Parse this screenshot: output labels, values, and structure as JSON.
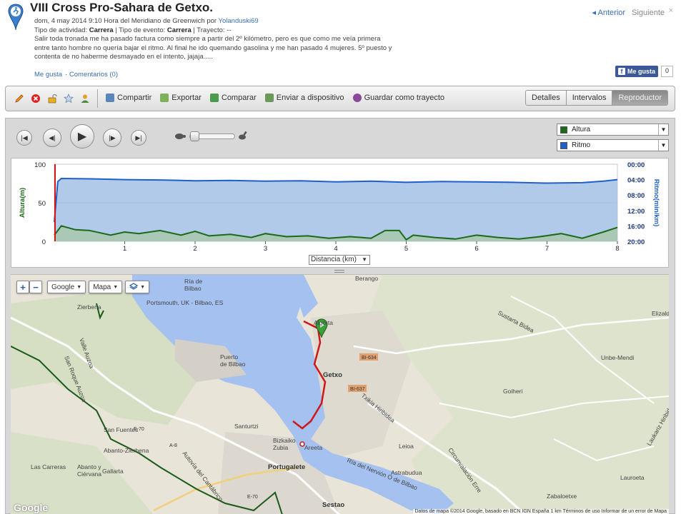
{
  "header": {
    "title": "VIII Cross Pro-Sahara de Getxo.",
    "date_prefix": "dom, 4 may 2014 9:10 Hora del Meridiano de Greenwich por ",
    "author": "Yolanduski69",
    "activity_prefix": "Tipo de actividad: ",
    "activity_type": "Carrera",
    "event_prefix": " | Tipo de evento: ",
    "event_type": "Carrera",
    "route_text": " | Trayecto: --",
    "description_lines": [
      "Salir toda tronada me ha pasado factura como siempre a partir del 2º kilómetro, pero es que como me veía primera",
      "entre tanto hombre no quería bajar el ritmo. Al final he ido quemando gasolina y me han pasado 4 mujeres. 5º puesto y",
      "contenta de no haberme desmayado en el intento, jajaja....."
    ],
    "like_link": "Me gusta",
    "comments_link": "Comentarios (0)",
    "prev": "Anterior",
    "next": "Siguiente",
    "close": "×",
    "fb_like": "Me gusta",
    "fb_count": "0"
  },
  "toolbar": {
    "actions": [
      "Compartir",
      "Exportar",
      "Comparar",
      "Enviar a dispositivo",
      "Guardar como trayecto"
    ],
    "tabs": [
      "Detalles",
      "Intervalos",
      "Reproductor"
    ],
    "active_tab": "Reproductor"
  },
  "player": {
    "series_select_1": "Altura",
    "series_select_2": "Ritmo",
    "series_color_1": "#1a6a1a",
    "series_color_2": "#1f5fc8",
    "slider_value": 0.0
  },
  "chart_data": {
    "type": "area",
    "xlabel": "Distancia (km)",
    "ylabel_left": "Altura(m)",
    "ylabel_right": "Ritmo(min/km)",
    "xlim": [
      0,
      8
    ],
    "ylim_left": [
      0,
      100
    ],
    "ylim_right": [
      "00:00",
      "20:00"
    ],
    "x_ticks": [
      "1",
      "2",
      "3",
      "4",
      "5",
      "6",
      "7",
      "8"
    ],
    "y_ticks_left": [
      "100",
      "50",
      "0"
    ],
    "y_ticks_right": [
      "00:00",
      "04:00",
      "08:00",
      "12:00",
      "16:00",
      "20:00"
    ],
    "series": [
      {
        "name": "Altura",
        "x": [
          0.0,
          0.1,
          0.3,
          0.5,
          0.8,
          1.0,
          1.2,
          1.5,
          1.8,
          2.0,
          2.2,
          2.5,
          2.8,
          3.0,
          3.3,
          3.6,
          3.9,
          4.2,
          4.5,
          4.7,
          4.9,
          5.0,
          5.1,
          5.4,
          5.7,
          6.0,
          6.3,
          6.6,
          6.9,
          7.2,
          7.5,
          7.8,
          8.0
        ],
        "values": [
          8,
          20,
          15,
          14,
          8,
          12,
          10,
          14,
          8,
          13,
          7,
          9,
          5,
          10,
          6,
          7,
          4,
          6,
          4,
          14,
          14,
          2,
          8,
          5,
          3,
          8,
          5,
          3,
          6,
          10,
          4,
          12,
          18
        ]
      },
      {
        "name": "Ritmo",
        "x": [
          0.0,
          0.05,
          0.1,
          0.5,
          1.0,
          1.5,
          2.0,
          2.5,
          3.0,
          3.5,
          4.0,
          4.5,
          5.0,
          5.5,
          6.0,
          6.5,
          7.0,
          7.5,
          7.8,
          8.0
        ],
        "values": [
          15.0,
          4.5,
          3.7,
          3.8,
          4.0,
          4.1,
          4.3,
          4.2,
          4.4,
          4.3,
          4.6,
          4.4,
          4.7,
          4.5,
          4.6,
          4.7,
          4.9,
          4.8,
          4.4,
          4.0
        ]
      }
    ]
  },
  "map": {
    "zoom_in": "+",
    "zoom_out": "−",
    "provider": "Google",
    "map_type": "Mapa",
    "labels": {
      "ria": "Ría de\nBilbao",
      "portsmouth": "Portsmouth, UK - Bilbao, ES",
      "puerto": "Puerto\nde Bilbao",
      "getxo": "Getxo",
      "algorta": "Algorta",
      "santurtzi": "Santurtzi",
      "portugalete": "Portugalete",
      "sestao": "Sestao",
      "bizkaiko": "Bizkaiko\nZubia",
      "areeta": "Areeta",
      "leioa": "Leioa",
      "astrabudua": "Astrabudua",
      "goiheri": "Goiheri",
      "zierbena": "Zierbena",
      "berango": "Berango",
      "unbe": "Unbe-Mendi",
      "elizalde": "Elizald",
      "lauroeta": "Lauroeta",
      "zabaloetxe": "Zabaloetxe",
      "ria_nervion": "Ría del Nervión O de Bilbao",
      "autovia": "Autovía del Cantábrico",
      "txikia": "Txikia Hiribidea",
      "circunvalacion": "Circunvalación Erre",
      "sanfuentes": "San Fuentes",
      "abanto": "Abanto-Zierbena",
      "carreras": "Las Carreras",
      "abanto2": "Abanto y\nCiérvana",
      "gallarta": "Gallarta",
      "sanroque": "San Roque Auzoa",
      "valle": "Valle Auzoa",
      "sustarta": "Sustarta Bidea",
      "bi634": "BI-634",
      "bi637": "BI-637",
      "a8": "A-8",
      "e70a": "E-70",
      "e70b": "E-70",
      "laukariz": "Laukariz Hiribidea"
    },
    "attribution": "Datos de mapa ©2014 Google, basado en BCN IGN España   1 km          Términos de uso   Informar de un error de Mapa",
    "google_logo": "Google"
  }
}
